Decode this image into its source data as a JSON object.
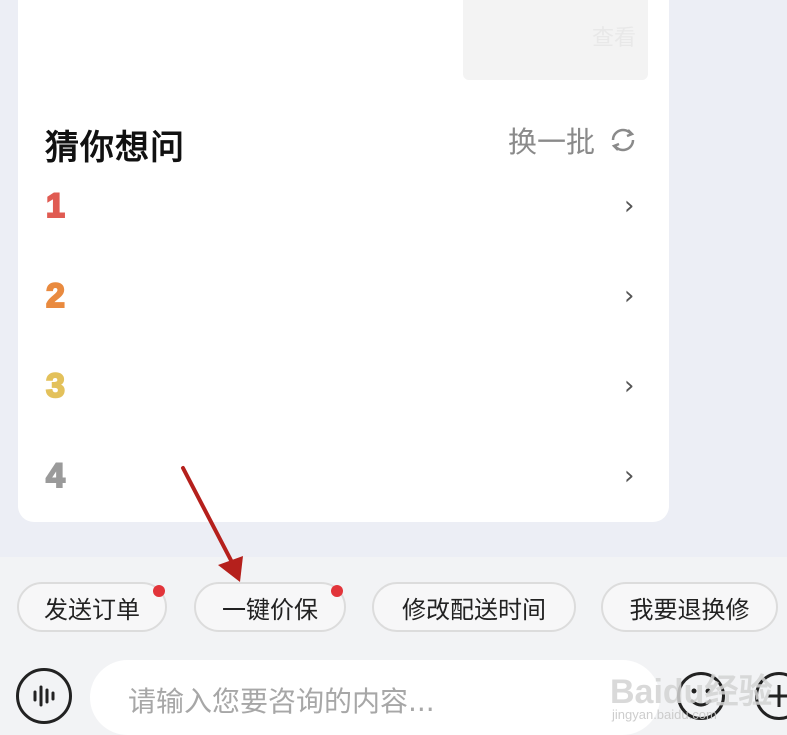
{
  "previous_message": {
    "button_text": "查看"
  },
  "suggestions": {
    "title": "猜你想问",
    "refresh_label": "换一批",
    "items": [
      {
        "number": "1",
        "color": "#e05b52"
      },
      {
        "number": "2",
        "color": "#e98a3f"
      },
      {
        "number": "3",
        "color": "#e3c15b"
      },
      {
        "number": "4",
        "color": "#9a9a9a"
      }
    ],
    "chevron": "›"
  },
  "quick_actions": [
    {
      "label": "发送订单",
      "has_dot": true
    },
    {
      "label": "一键价保",
      "has_dot": true
    },
    {
      "label": "修改配送时间",
      "has_dot": false
    },
    {
      "label": "我要退换修",
      "has_dot": false
    }
  ],
  "input": {
    "placeholder": "请输入您要咨询的内容..."
  },
  "watermark": {
    "brand": "Baidu经验",
    "url": "jingyan.baidu.com"
  },
  "colors": {
    "dot": "#e2343a",
    "arrow": "#b5201c"
  }
}
